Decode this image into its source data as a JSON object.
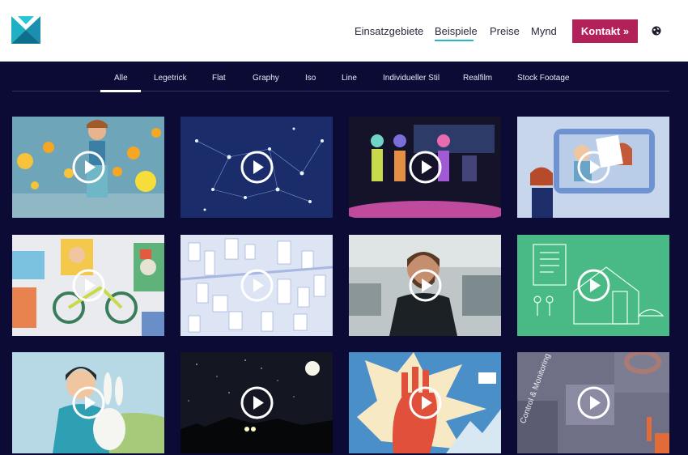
{
  "nav": {
    "items": [
      {
        "label": "Einsatzgebiete"
      },
      {
        "label": "Beispiele"
      },
      {
        "label": "Preise"
      },
      {
        "label": "Mynd"
      }
    ],
    "contact_label": "Kontakt »"
  },
  "filters": [
    {
      "label": "Alle"
    },
    {
      "label": "Legetrick"
    },
    {
      "label": "Flat"
    },
    {
      "label": "Graphy"
    },
    {
      "label": "Iso"
    },
    {
      "label": "Line"
    },
    {
      "label": "Individueller Stil"
    },
    {
      "label": "Realfilm"
    },
    {
      "label": "Stock Footage"
    }
  ],
  "tiles_overlay_text": {
    "tile12": "Control & Monitoring"
  },
  "colors": {
    "background": "#0b0b35",
    "accent_underline": "#21b8c8",
    "contact_button": "#b3215b"
  }
}
